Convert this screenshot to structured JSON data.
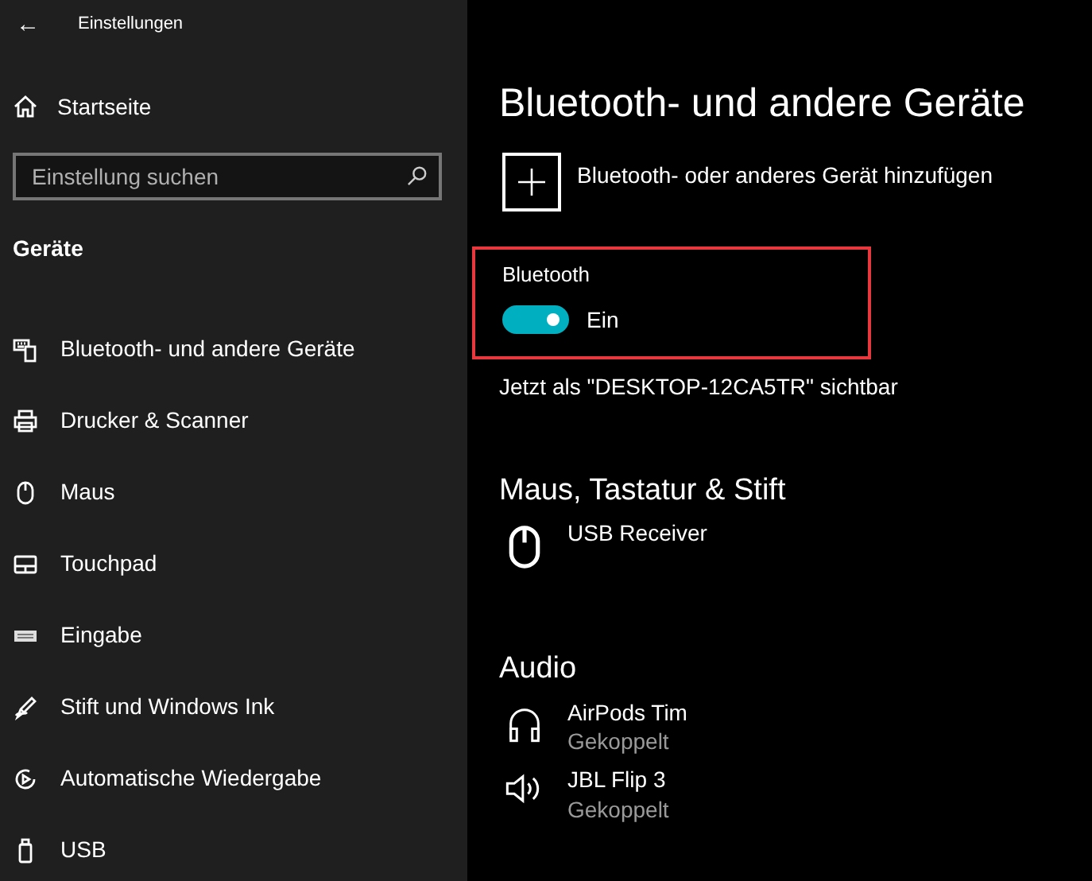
{
  "window": {
    "title": "Einstellungen",
    "back": "←"
  },
  "sidebar": {
    "home": "Startseite",
    "search": {
      "placeholder": "Einstellung suchen"
    },
    "section": "Geräte",
    "items": [
      {
        "label": "Bluetooth- und andere Geräte",
        "kind": "bluetooth"
      },
      {
        "label": "Drucker & Scanner",
        "kind": "printer"
      },
      {
        "label": "Maus",
        "kind": "mouse"
      },
      {
        "label": "Touchpad",
        "kind": "touchpad"
      },
      {
        "label": "Eingabe",
        "kind": "keyboard"
      },
      {
        "label": "Stift und Windows Ink",
        "kind": "pen"
      },
      {
        "label": "Automatische Wiedergabe",
        "kind": "autoplay"
      },
      {
        "label": "USB",
        "kind": "usb"
      }
    ]
  },
  "main": {
    "title": "Bluetooth- und andere Geräte",
    "add_device": "Bluetooth- oder anderes Gerät hinzufügen",
    "bluetooth": {
      "label": "Bluetooth",
      "on": true,
      "state_text": "Ein",
      "highlighted": true
    },
    "visibility": "Jetzt als \"DESKTOP-12CA5TR\" sichtbar",
    "sections": [
      {
        "heading": "Maus, Tastatur & Stift",
        "devices": [
          {
            "name": "USB Receiver",
            "kind": "mouse"
          }
        ]
      },
      {
        "heading": "Audio",
        "devices": [
          {
            "name": "AirPods Tim",
            "status": "Gekoppelt",
            "kind": "headphones"
          },
          {
            "name": "JBL Flip 3",
            "status": "Gekoppelt",
            "kind": "speaker"
          }
        ]
      }
    ]
  }
}
